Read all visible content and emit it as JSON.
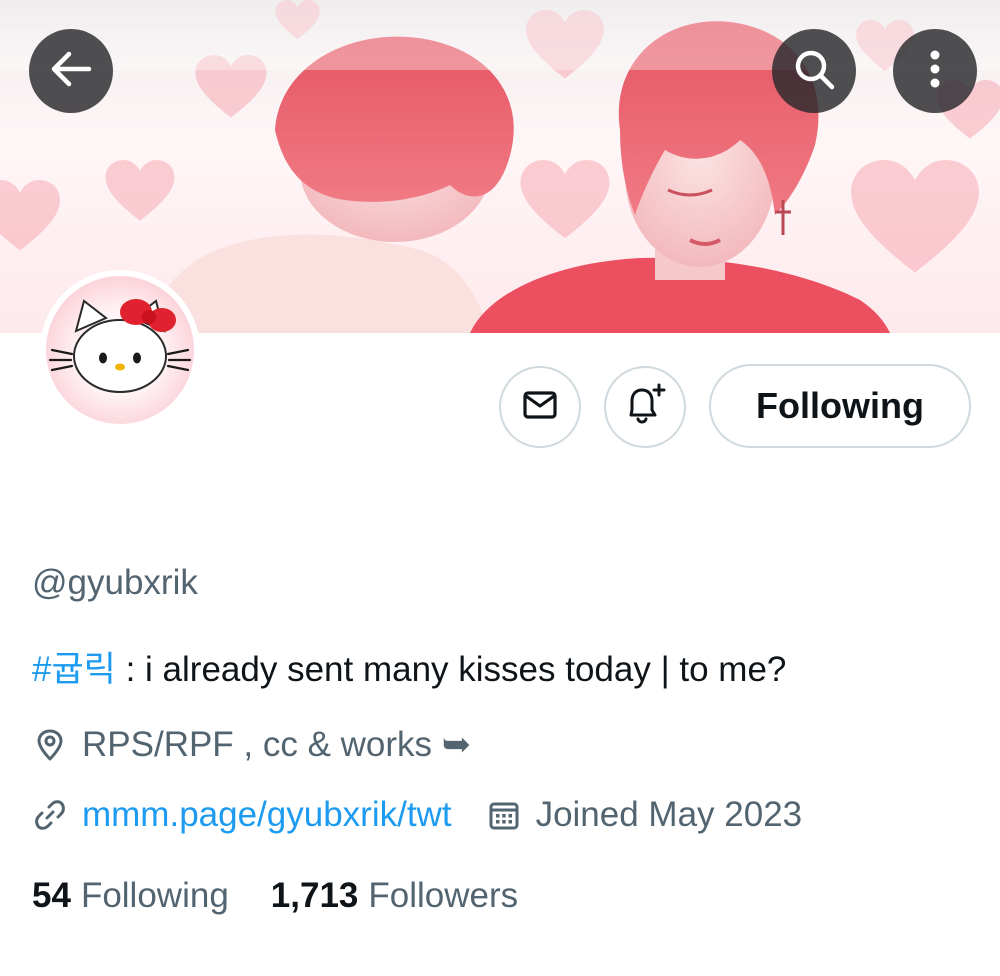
{
  "header": {
    "back_icon": "arrow-left-icon",
    "search_icon": "search-icon",
    "more_icon": "more-vertical-icon"
  },
  "avatar": {
    "icon": "hello-kitty-avatar"
  },
  "actions": {
    "message_icon": "envelope-icon",
    "notify_icon": "bell-plus-icon",
    "follow_label": "Following"
  },
  "profile": {
    "handle": "@gyubxrik",
    "bio_hashtag": "#귭릭",
    "bio_text": " : i already sent many kisses today | to me?",
    "location": "RPS/RPF , cc & works ➥",
    "website": "mmm.page/gyubxrik/twt",
    "joined": "Joined May 2023"
  },
  "stats": {
    "following_count": "54",
    "following_label": "Following",
    "followers_count": "1,713",
    "followers_label": "Followers"
  },
  "colors": {
    "accent": "#1d9bf0",
    "secondary_text": "#536471",
    "primary_text": "#0f1419",
    "border": "#cfd9de",
    "banner_tint": "#e8495a"
  }
}
